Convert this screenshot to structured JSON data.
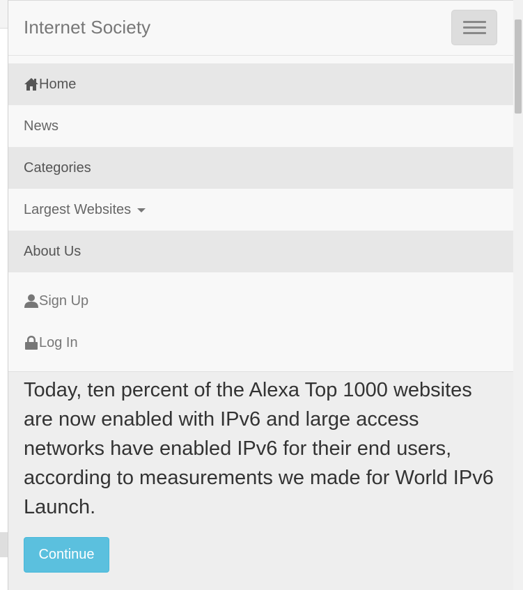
{
  "navbar": {
    "brand": "Internet Society",
    "toggle_icon": "hamburger-menu-icon",
    "items": [
      {
        "label": "Home",
        "icon": "home-icon"
      },
      {
        "label": "News"
      },
      {
        "label": "Categories"
      },
      {
        "label": "Largest Websites",
        "icon": "caret-down-icon"
      },
      {
        "label": "About Us"
      }
    ],
    "account_items": [
      {
        "label": "Sign Up",
        "icon": "user-icon"
      },
      {
        "label": "Log In",
        "icon": "lock-icon"
      }
    ]
  },
  "main": {
    "text": "Today, ten percent of the Alexa Top 1000 websites are now enabled with IPv6 and large access networks have enabled IPv6 for their end users, according to measurements we made for World IPv6 Launch.",
    "continue_label": "Continue"
  },
  "colors": {
    "button_info": "#5bc0de",
    "navbar_bg": "#f8f8f8",
    "page_bg": "#eeeeee"
  }
}
